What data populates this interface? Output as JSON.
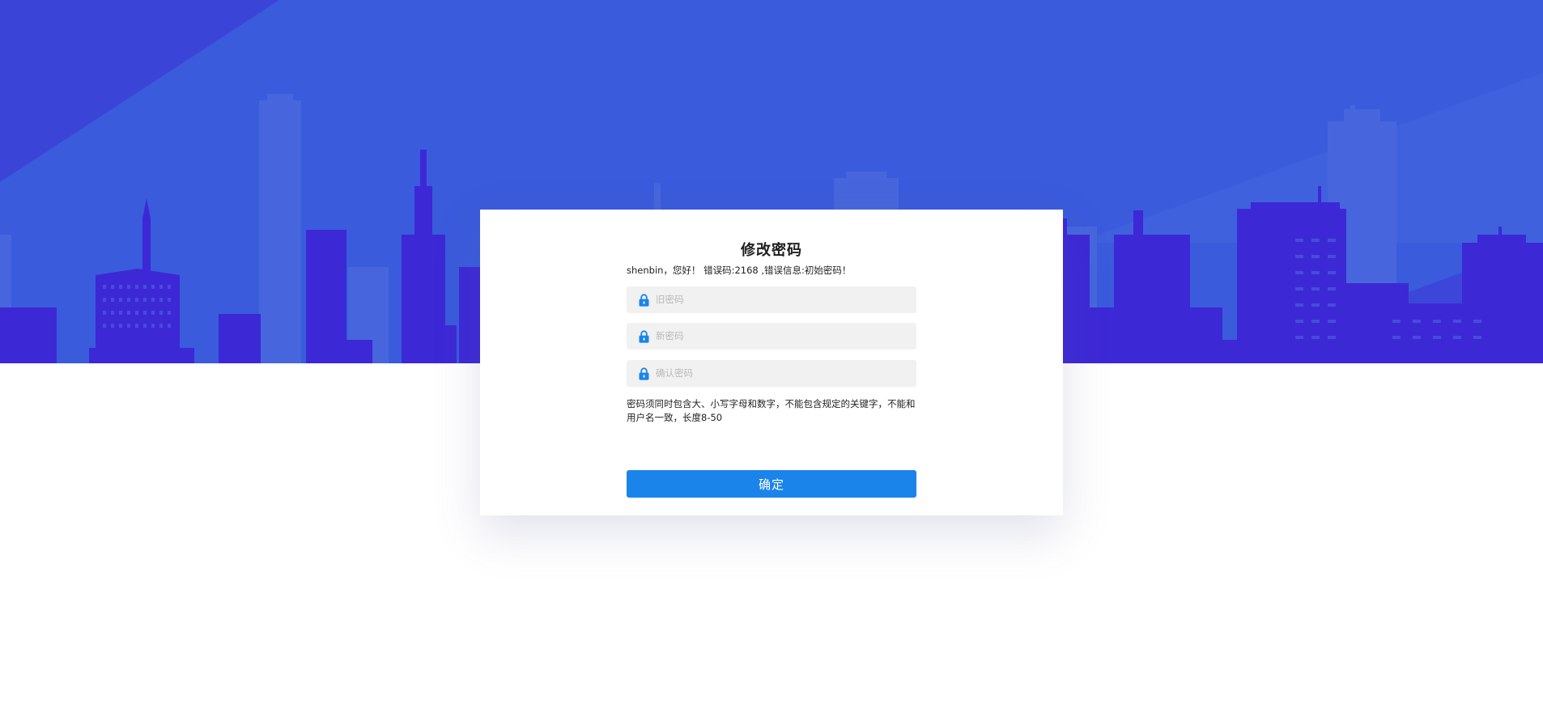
{
  "background": {
    "sky_color": "#3a5bdc",
    "building_color": "#3a1fd6"
  },
  "form": {
    "title": "修改密码",
    "greeting": "shenbin，您好！ 错误码:2168 ,错误信息:初始密码！",
    "old_password": {
      "placeholder": "旧密码",
      "value": "",
      "icon": "lock-icon"
    },
    "new_password": {
      "placeholder": "新密码",
      "value": "",
      "icon": "lock-icon"
    },
    "confirm_password": {
      "placeholder": "确认密码",
      "value": "",
      "icon": "lock-icon"
    },
    "hint": "密码须同时包含大、小写字母和数字，不能包含规定的关键字，不能和用户名一致，长度8-50",
    "submit_label": "确定",
    "accent_color": "#1b84ea"
  }
}
